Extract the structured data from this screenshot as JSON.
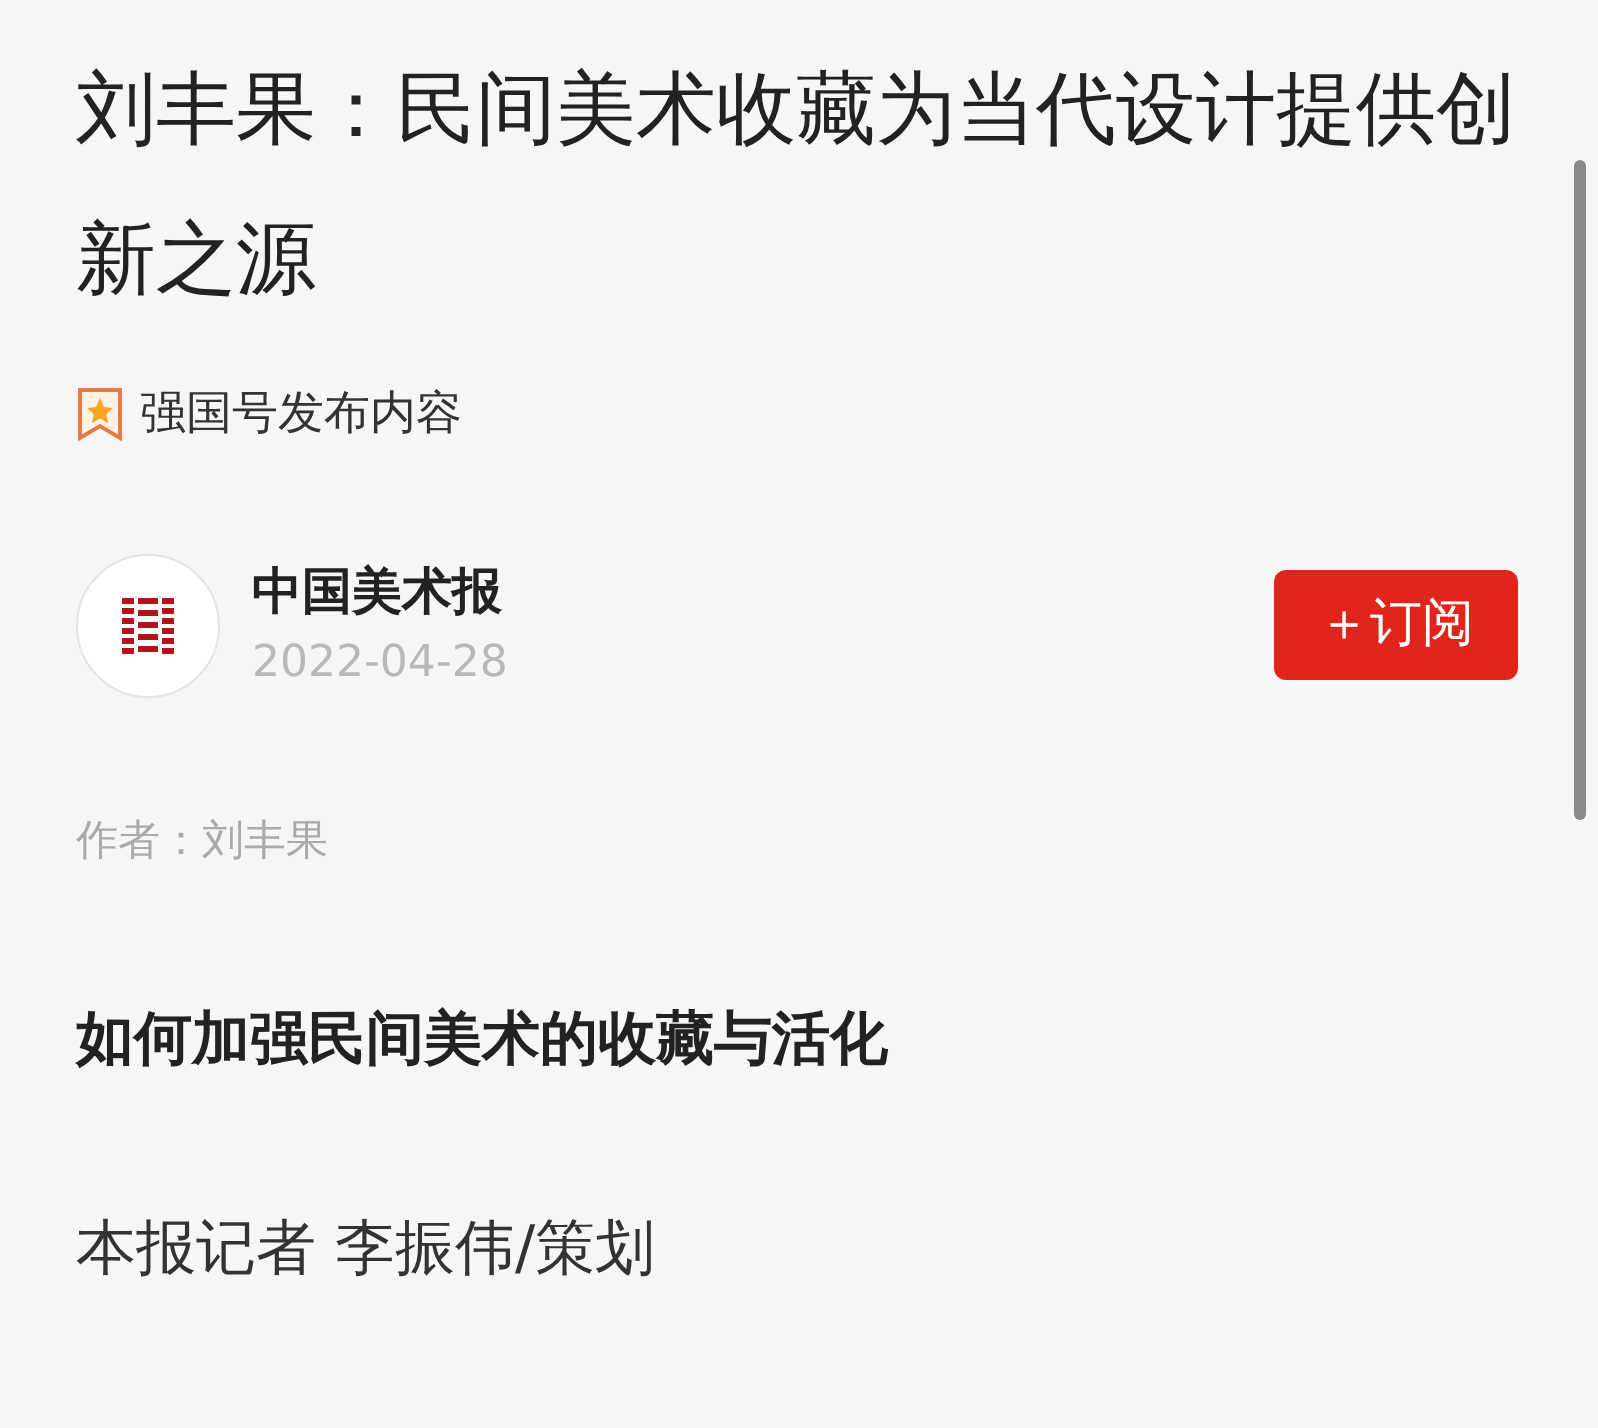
{
  "article": {
    "title": "刘丰果：民间美术收藏为当代设计提供创新之源",
    "source_label": "强国号发布内容"
  },
  "publisher": {
    "name": "中国美术报",
    "date": "2022-04-28",
    "subscribe": {
      "icon": "＋",
      "label": "订阅"
    }
  },
  "author": "作者：刘丰果",
  "paragraphs": [
    {
      "kind": "heading",
      "text": "如何加强民间美术的收藏与活化"
    },
    {
      "kind": "body",
      "text": "本报记者 李振伟/策划"
    }
  ]
}
